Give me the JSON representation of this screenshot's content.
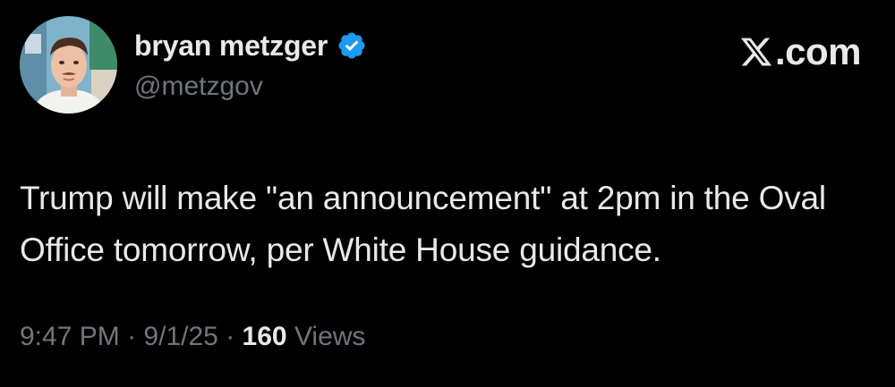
{
  "author": {
    "display_name": "bryan metzger",
    "handle": "@metzgov",
    "verified": true,
    "verified_color": "#1d9bf0"
  },
  "brand": {
    "domain": ".com",
    "icon": "x-logo-icon"
  },
  "tweet": {
    "text": "Trump will make \"an announcement\" at 2pm in the Oval Office tomorrow, per White House guidance."
  },
  "meta": {
    "time": "9:47 PM",
    "separator": "·",
    "date": "9/1/25",
    "views_count": "160",
    "views_label": "Views"
  },
  "colors": {
    "background": "#000000",
    "primary_text": "#e7e9ea",
    "secondary_text": "#71767b"
  }
}
